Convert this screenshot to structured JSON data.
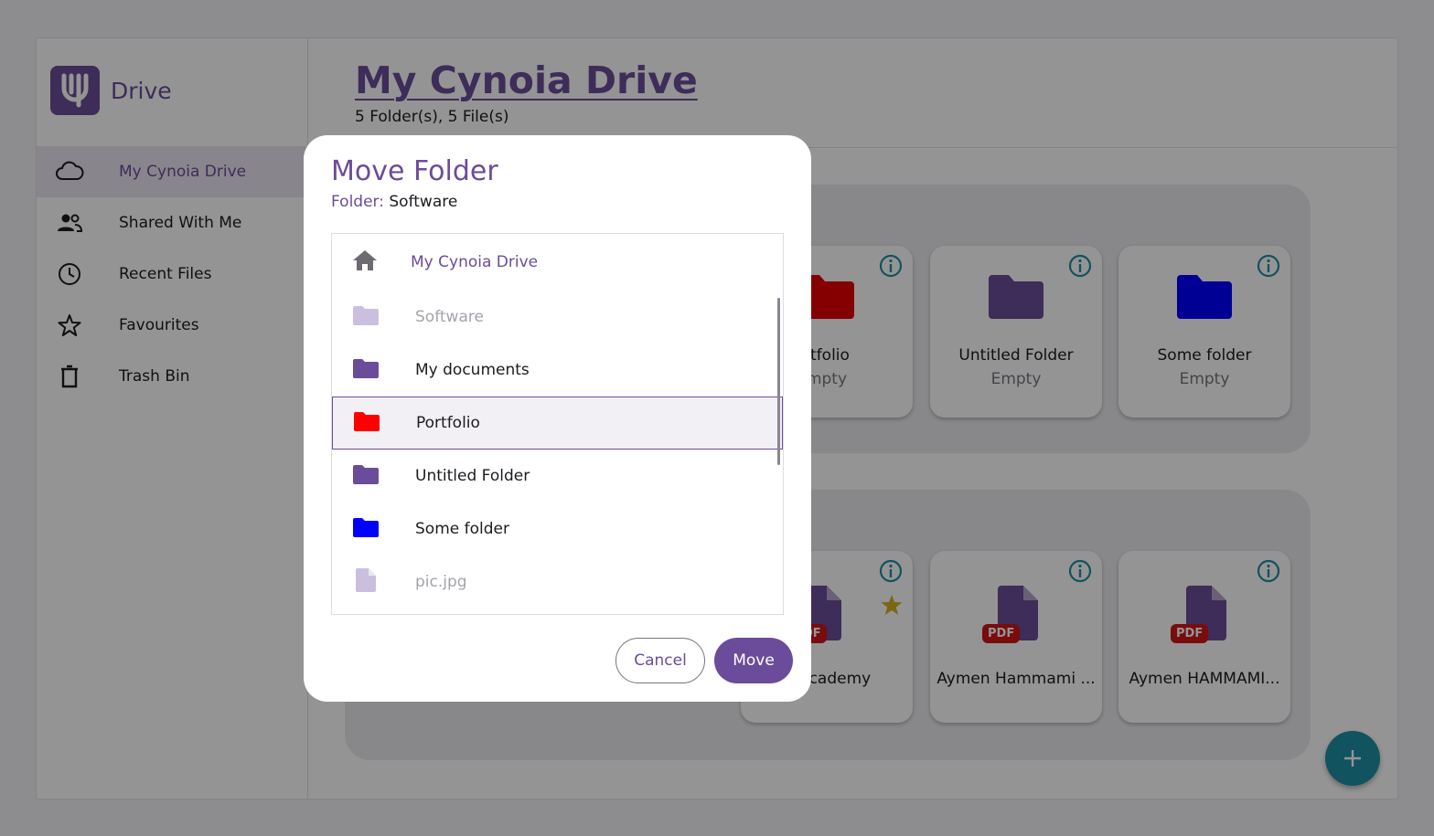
{
  "app": {
    "brand_name": "Drive",
    "accent": "#6b4c9a"
  },
  "sidebar": {
    "items": [
      {
        "label": "My Cynoia Drive",
        "icon": "cloud-icon"
      },
      {
        "label": "Shared With Me",
        "icon": "people-icon"
      },
      {
        "label": "Recent Files",
        "icon": "clock-icon"
      },
      {
        "label": "Favourites",
        "icon": "star-icon"
      },
      {
        "label": "Trash Bin",
        "icon": "trash-icon"
      }
    ]
  },
  "header": {
    "title": "My Cynoia Drive",
    "subtitle": "5 Folder(s), 5 File(s)"
  },
  "folders": [
    {
      "name": "rtfolio",
      "sub": "mpty",
      "color": "#e60000"
    },
    {
      "name": "Untitled Folder",
      "sub": "Empty",
      "color": "#3d2a5c"
    },
    {
      "name": "Some folder",
      "sub": "Empty",
      "color": "#0b0bb8"
    }
  ],
  "files": [
    {
      "name": "ntAcademy",
      "badge": "DF",
      "starred": true
    },
    {
      "name": "Aymen Hammami ...",
      "badge": "PDF"
    },
    {
      "name": "Aymen HAMMAMI...",
      "badge": "PDF"
    }
  ],
  "dialog": {
    "title": "Move Folder",
    "subtitle_key": "Folder:",
    "subtitle_value": "Software",
    "root_label": "My Cynoia Drive",
    "items": [
      {
        "label": "Software",
        "type": "folder",
        "color": "#cbbfe0",
        "state": "disabled"
      },
      {
        "label": "My documents",
        "type": "folder",
        "color": "#6b4c9a",
        "state": "normal"
      },
      {
        "label": "Portfolio",
        "type": "folder",
        "color": "#ff0000",
        "state": "selected"
      },
      {
        "label": "Untitled Folder",
        "type": "folder",
        "color": "#6b4c9a",
        "state": "normal"
      },
      {
        "label": "Some folder",
        "type": "folder",
        "color": "#0000ff",
        "state": "normal"
      },
      {
        "label": "pic.jpg",
        "type": "file",
        "color": "#cbbfe0",
        "state": "disabled"
      }
    ],
    "cancel_label": "Cancel",
    "move_label": "Move"
  },
  "fab": {
    "label": "+"
  }
}
